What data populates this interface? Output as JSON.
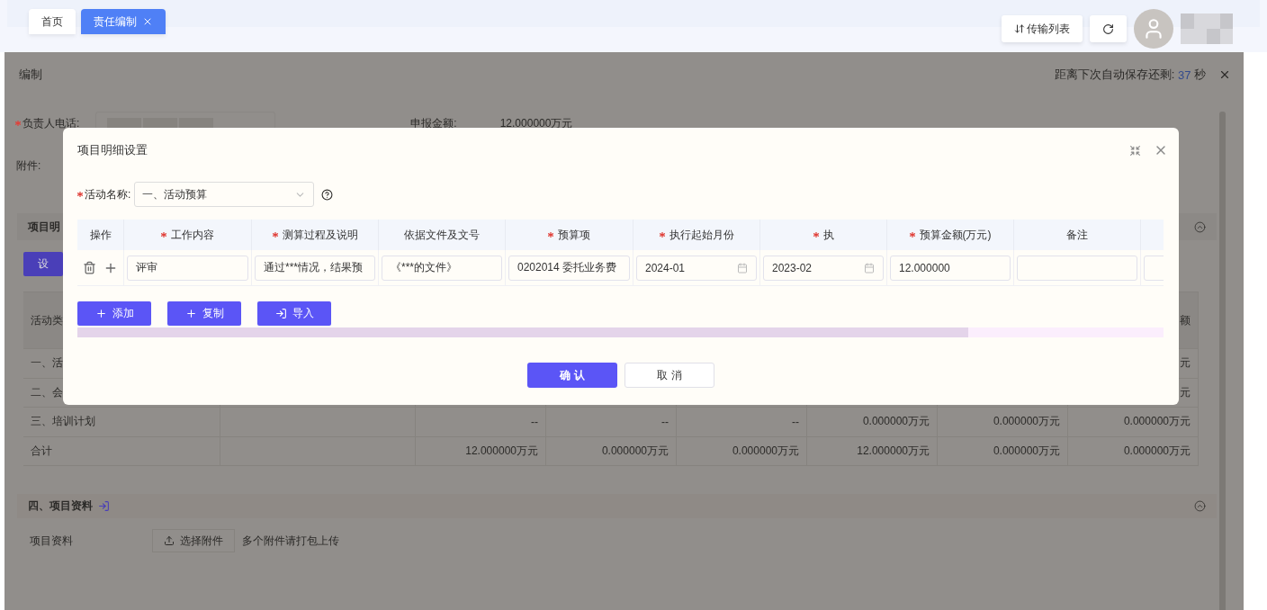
{
  "tabs": [
    {
      "label": "首页",
      "selected": false,
      "closable": false
    },
    {
      "label": "责任编制",
      "selected": true,
      "closable": true
    }
  ],
  "toolbar": {
    "transfer_button": "传输列表"
  },
  "page": {
    "title": "编制",
    "autosave": {
      "label": "距离下次自动保存还剩:",
      "seconds": "37",
      "unit": "秒"
    },
    "phone": {
      "label": "负责人电话:",
      "required": true
    },
    "amount": {
      "label": "申报金额:",
      "value": "12.000000万元"
    },
    "attachment_label": "附件:",
    "detail_section": {
      "title": "项目明",
      "button": "设"
    },
    "summary_table": {
      "columns": [
        "活动类",
        null,
        null,
        null,
        null,
        null,
        null,
        "额"
      ],
      "rows": [
        [
          "一、活",
          null,
          null,
          null,
          null,
          null,
          null,
          "元"
        ],
        [
          "二、会",
          null,
          null,
          null,
          null,
          null,
          null,
          "元"
        ],
        [
          "三、培训计划",
          null,
          "--",
          "--",
          "--",
          "0.000000万元",
          "0.000000万元",
          "0.000000万元"
        ],
        [
          "合计",
          null,
          "12.000000万元",
          "0.000000万元",
          "0.000000万元",
          "12.000000万元",
          "0.000000万元",
          "0.000000万元"
        ]
      ]
    },
    "materials_section": {
      "title": "四、项目资料",
      "label": "项目资料",
      "upload_button": "选择附件",
      "hint": "多个附件请打包上传"
    }
  },
  "dialog": {
    "title": "项目明细设置",
    "activity": {
      "label": "活动名称:",
      "required": true,
      "value": "一、活动预算"
    },
    "columns": [
      {
        "label": "操作",
        "required": false
      },
      {
        "label": "工作内容",
        "required": true
      },
      {
        "label": "测算过程及说明",
        "required": true
      },
      {
        "label": "依据文件及文号",
        "required": false
      },
      {
        "label": "预算项",
        "required": true
      },
      {
        "label": "执行起始月份",
        "required": true
      },
      {
        "label": "执",
        "required": true
      },
      {
        "label": "预算金额(万元)",
        "required": true
      },
      {
        "label": "备注",
        "required": false
      },
      {
        "required": false
      }
    ],
    "rows": [
      [
        {
          "kind": "actions"
        },
        {
          "kind": "input",
          "value": "评审"
        },
        {
          "kind": "input",
          "value": "通过***情况，结果预"
        },
        {
          "kind": "input",
          "value": "《***的文件》"
        },
        {
          "kind": "input",
          "value": "0202014 委托业务费"
        },
        {
          "kind": "date",
          "value": "2024-01"
        },
        {
          "kind": "date",
          "value": "2023-02"
        },
        {
          "kind": "input",
          "value": "12.000000"
        },
        {
          "kind": "input"
        },
        {
          "kind": "input"
        }
      ]
    ],
    "table_buttons": [
      {
        "label": "添加",
        "kind": "plus"
      },
      {
        "label": "复制",
        "kind": "plus"
      },
      {
        "label": "导入",
        "kind": "import"
      }
    ],
    "confirm_button": "确 认",
    "cancel_button": "取 消"
  }
}
